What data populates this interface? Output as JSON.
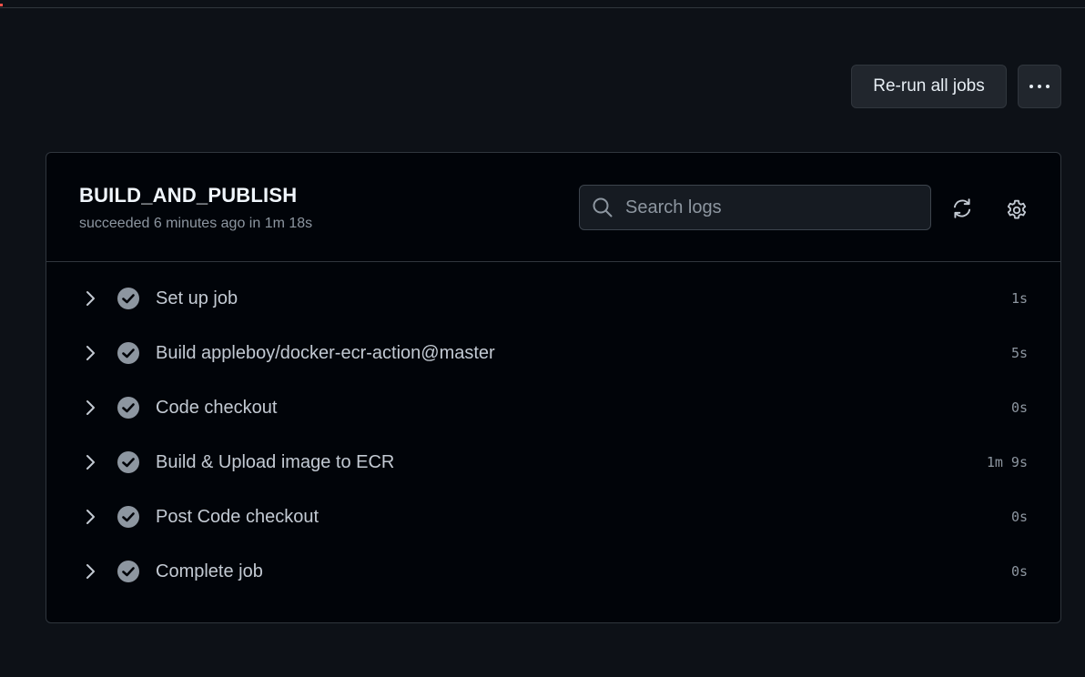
{
  "toolbar": {
    "rerun_label": "Re-run all jobs",
    "more_icon": "kebab-horizontal-icon"
  },
  "job": {
    "title": "BUILD_AND_PUBLISH",
    "status": "succeeded 6 minutes ago in 1m 18s"
  },
  "search": {
    "placeholder": "Search logs",
    "value": ""
  },
  "icons": {
    "refresh": "refresh-icon",
    "settings": "gear-icon",
    "step_expand": "chevron-right-icon",
    "step_status": "check-circle-icon"
  },
  "colors": {
    "background": "#0d1117",
    "panel": "#010409",
    "border": "#30363d",
    "check": "#8d96a0"
  },
  "steps": [
    {
      "label": "Set up job",
      "duration": "1s"
    },
    {
      "label": "Build appleboy/docker-ecr-action@master",
      "duration": "5s"
    },
    {
      "label": "Code checkout",
      "duration": "0s"
    },
    {
      "label": "Build & Upload image to ECR",
      "duration": "1m 9s"
    },
    {
      "label": "Post Code checkout",
      "duration": "0s"
    },
    {
      "label": "Complete job",
      "duration": "0s"
    }
  ]
}
